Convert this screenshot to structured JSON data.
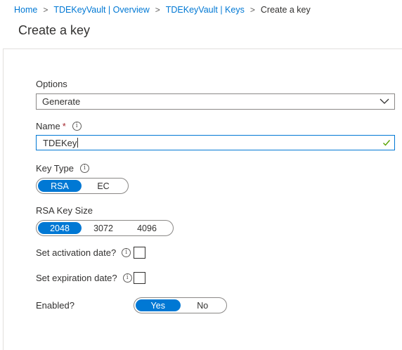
{
  "breadcrumb": {
    "items": [
      "Home",
      "TDEKeyVault | Overview",
      "TDEKeyVault | Keys"
    ],
    "separator": ">",
    "current": "Create a key"
  },
  "page": {
    "title": "Create a key"
  },
  "form": {
    "options": {
      "label": "Options",
      "value": "Generate",
      "icon": "chevron-down-icon"
    },
    "name": {
      "label": "Name",
      "required_marker": "*",
      "info": "i",
      "value": "TDEKey",
      "valid_icon": "checkmark-icon"
    },
    "key_type": {
      "label": "Key Type",
      "info": "i",
      "options": [
        "RSA",
        "EC"
      ],
      "selected": "RSA"
    },
    "rsa_key_size": {
      "label": "RSA Key Size",
      "options": [
        "2048",
        "3072",
        "4096"
      ],
      "selected": "2048"
    },
    "activation": {
      "label": "Set activation date?",
      "info": "i",
      "checked": false
    },
    "expiration": {
      "label": "Set expiration date?",
      "info": "i",
      "checked": false
    },
    "enabled": {
      "label": "Enabled?",
      "options": [
        "Yes",
        "No"
      ],
      "selected": "Yes"
    }
  },
  "colors": {
    "accent": "#0078d4",
    "border": "#8a8886",
    "text": "#323130",
    "required": "#a4262c",
    "valid": "#57a300"
  }
}
